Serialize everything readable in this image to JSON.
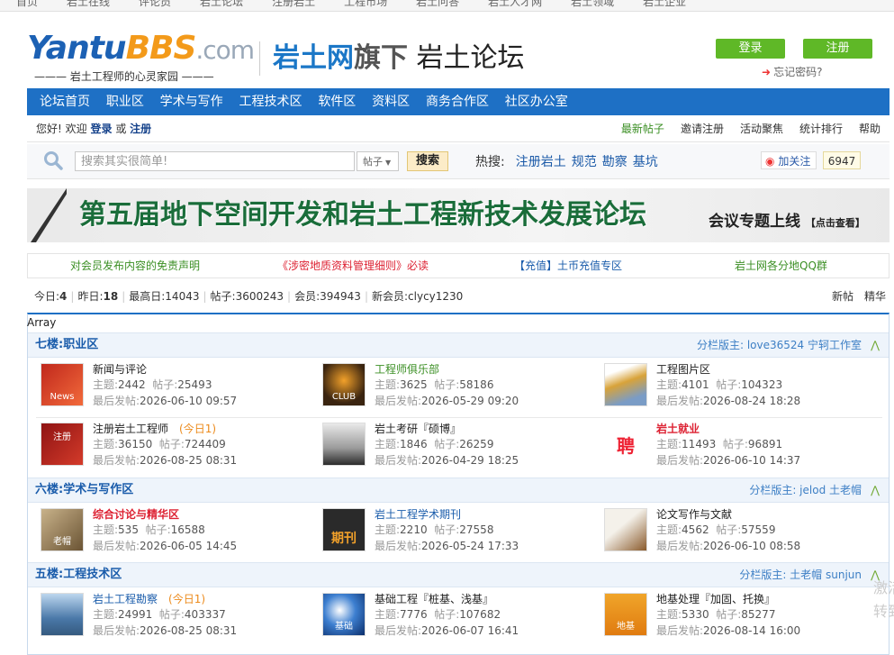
{
  "topnav": [
    "首页",
    "岩土在线",
    "评论员",
    "岩土论坛",
    "注册岩土",
    "工程市场",
    "岩土问答",
    "岩土人才网",
    "岩土领域",
    "岩土企业"
  ],
  "logo": {
    "brand_a": "Yantu",
    "brand_b": "BBS",
    ".com": ".com",
    "slogan": "——— 岩土工程师的心灵家园 ———"
  },
  "header": {
    "title_a": "岩土网",
    "title_b": "旗下",
    "title_c": " 岩土论坛"
  },
  "auth": {
    "login": "登录",
    "register": "注册",
    "forgot": "忘记密码?"
  },
  "mainnav": [
    "论坛首页",
    "职业区",
    "学术与写作",
    "工程技术区",
    "软件区",
    "资料区",
    "商务合作区",
    "社区办公室"
  ],
  "userbar": {
    "greet": "您好!",
    "welcome": "欢迎",
    "login": "登录",
    "or": "或",
    "register": "注册",
    "links": [
      "最新帖子",
      "邀请注册",
      "活动聚焦",
      "统计排行",
      "帮助"
    ]
  },
  "search": {
    "placeholder": "搜索其实很简单!",
    "type": "帖子",
    "button": "搜索",
    "hot_label": "热搜:",
    "hot": [
      "注册岩土",
      "规范",
      "勘察",
      "基坑"
    ],
    "follow": "加关注",
    "follow_count": "6947"
  },
  "banner": {
    "title": "第五届地下空间开发和岩土工程新技术发展论坛",
    "sub": "会议专题上线",
    "sub_small": "【点击查看】"
  },
  "notices": [
    "对会员发布内容的免责声明",
    "《涉密地质资料管理细则》必读",
    "【充值】土币充值专区",
    "岩土网各分地QQ群"
  ],
  "stats": {
    "today_label": "今日:",
    "today": "4",
    "yesterday_label": "昨日:",
    "yesterday": "18",
    "max_label": "最高日:",
    "max": "14043",
    "posts_label": "帖子:",
    "posts": "3600243",
    "members_label": "会员:",
    "members": "394943",
    "newest_label": "新会员:",
    "newest": "clycy1230",
    "links": [
      "新帖",
      "精华"
    ]
  },
  "array_text": "Array",
  "labels": {
    "topics": "主题:",
    "posts": "帖子:",
    "last": "最后发帖:"
  },
  "categories": [
    {
      "title": "七楼:职业区",
      "mods": "分栏版主: love36524 宁轲工作室",
      "fold": "⋀",
      "forums": [
        {
          "name": "新闻与评论",
          "topics": "2442",
          "posts": "25493",
          "last": "2026-06-10 09:57",
          "today": "",
          "icon": "News"
        },
        {
          "name": "工程师俱乐部",
          "topics": "3625",
          "posts": "58186",
          "last": "2026-05-29 09:20",
          "today": "",
          "icon": "CLUB"
        },
        {
          "name": "工程图片区",
          "topics": "4101",
          "posts": "104323",
          "last": "2026-08-24 18:28",
          "today": "",
          "icon": ""
        },
        {
          "name": "注册岩土工程师",
          "topics": "36150",
          "posts": "724409",
          "last": "2026-08-25 08:31",
          "today": "(今日1)",
          "icon": "注册"
        },
        {
          "name": "岩土考研『硕博』",
          "topics": "1846",
          "posts": "26259",
          "last": "2026-04-29 18:25",
          "today": "",
          "icon": ""
        },
        {
          "name": "岩土就业",
          "topics": "11493",
          "posts": "96891",
          "last": "2026-06-10 14:37",
          "today": "",
          "icon": "聘"
        }
      ]
    },
    {
      "title": "六楼:学术与写作区",
      "mods": "分栏版主: jelod 土老帽",
      "fold": "⋀",
      "forums": [
        {
          "name": "综合讨论与精华区",
          "topics": "535",
          "posts": "16588",
          "last": "2026-06-05 14:45",
          "today": "",
          "icon": "老帽"
        },
        {
          "name": "岩土工程学术期刊",
          "topics": "2210",
          "posts": "27558",
          "last": "2026-05-24 17:33",
          "today": "",
          "icon": "期刊"
        },
        {
          "name": "论文写作与文献",
          "topics": "4562",
          "posts": "57559",
          "last": "2026-06-10 08:58",
          "today": "",
          "icon": ""
        }
      ]
    },
    {
      "title": "五楼:工程技术区",
      "mods": "分栏版主: 土老帽 sunjun",
      "fold": "⋀",
      "forums": [
        {
          "name": "岩土工程勘察",
          "topics": "24991",
          "posts": "403337",
          "last": "2026-08-25 08:31",
          "today": "(今日1)",
          "icon": ""
        },
        {
          "name": "基础工程『桩基、浅基』",
          "topics": "7776",
          "posts": "107682",
          "last": "2026-06-07 16:41",
          "today": "",
          "icon": "基础"
        },
        {
          "name": "地基处理『加固、托换』",
          "topics": "5330",
          "posts": "85277",
          "last": "2026-08-14 16:00",
          "today": "",
          "icon": "地基"
        }
      ]
    }
  ],
  "watermark": "激活\n转到"
}
